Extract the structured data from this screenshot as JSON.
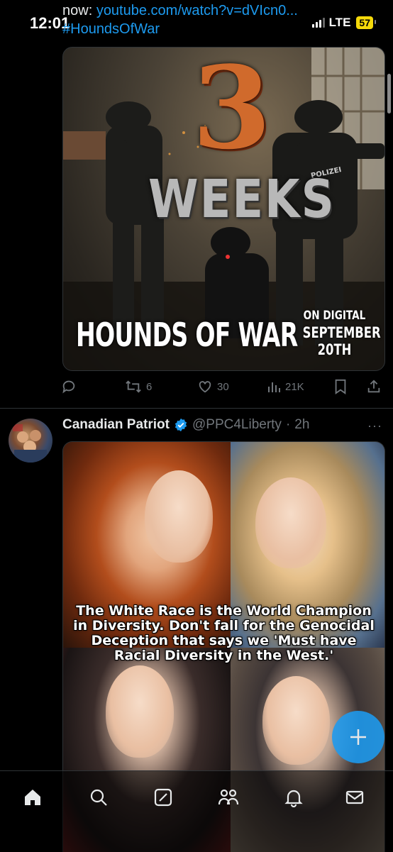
{
  "status_bar": {
    "time": "12:01",
    "network": "LTE",
    "battery": "57"
  },
  "tweet1": {
    "text_line1_prefix": "now: ",
    "text_link": "youtube.com/watch?v=dVIcn0...",
    "hashtag": "#HoundsOfWar",
    "media": {
      "big_number": "3",
      "weeks": "WEEKS",
      "title": "HOUNDS OF WAR",
      "release_line1": "ON DIGITAL",
      "release_line2": "SEPTEMBER",
      "release_line3": "20TH",
      "patch_text": "POLIZEI"
    },
    "actions": {
      "reposts": "6",
      "likes": "30",
      "views": "21K"
    }
  },
  "tweet2": {
    "author_name": "Canadian Patriot",
    "handle": "@PPC4Liberty",
    "separator": "·",
    "time": "2h",
    "more": "···",
    "media_text_line1": "The White Race is the World Champion",
    "media_text_line2": "in Diversity. Don't fall for the Genocidal",
    "media_text_line3": "Deception that says we 'Must have",
    "media_text_line4": "Racial Diversity in the West.'"
  },
  "colors": {
    "background": "#000000",
    "link": "#1d9bf0",
    "muted": "#71767b",
    "verified": "#1d9bf0",
    "battery": "#f5d90a"
  },
  "tabs": [
    "home-icon",
    "search-icon",
    "grok-icon",
    "communities-icon",
    "notifications-icon",
    "messages-icon"
  ]
}
